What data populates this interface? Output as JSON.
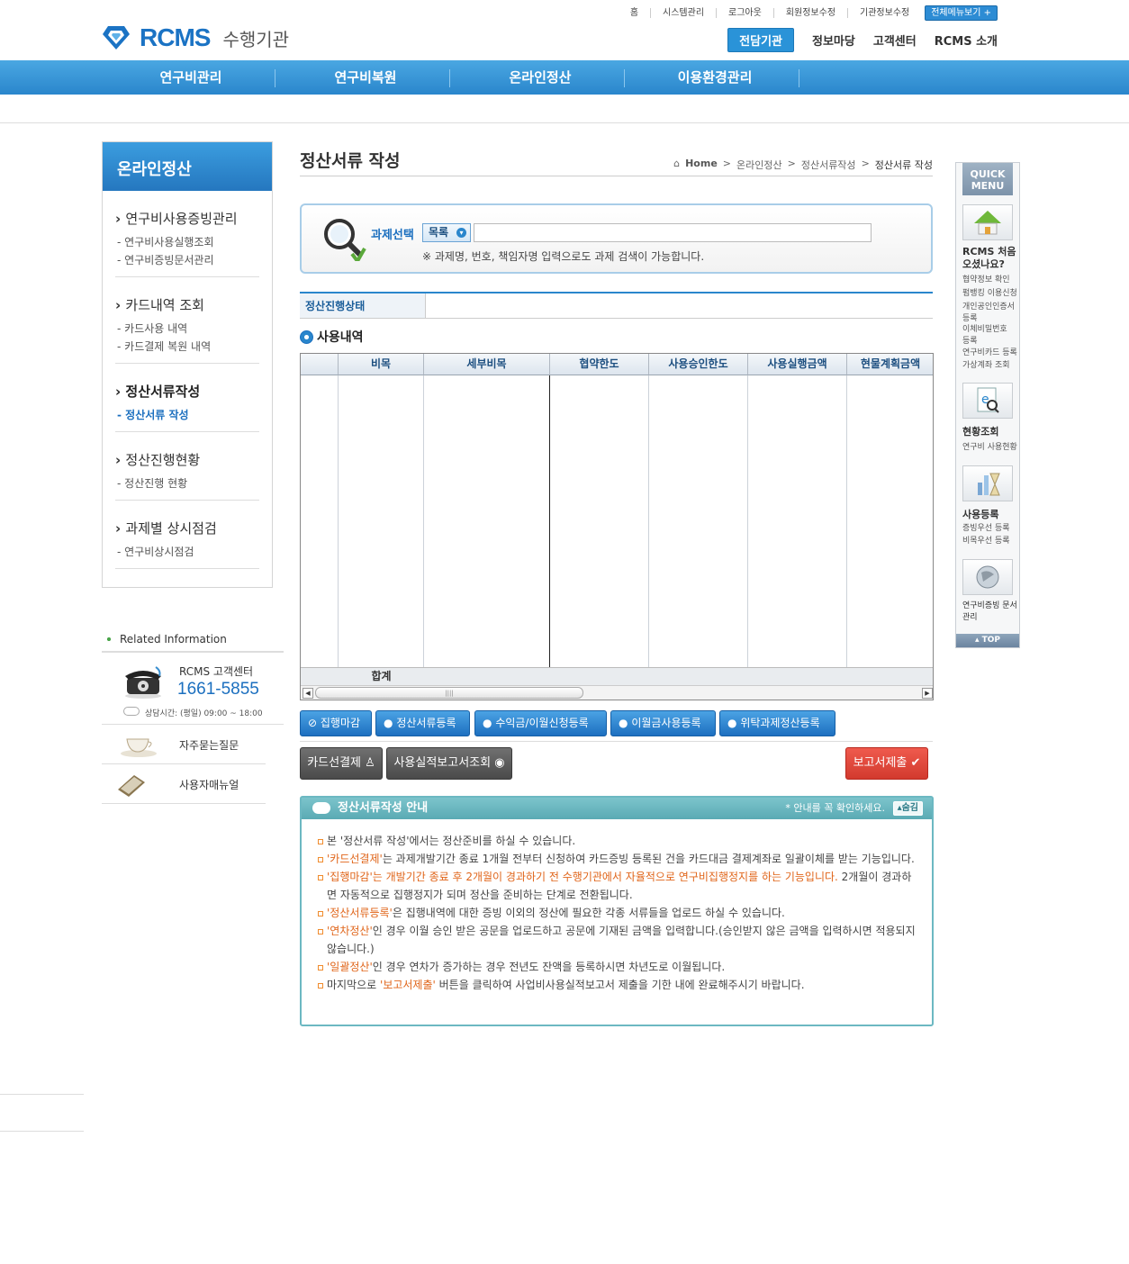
{
  "topnav": {
    "items": [
      "홈",
      "시스템관리",
      "로그아웃",
      "회원정보수정",
      "기관정보수정"
    ],
    "all_menu": "전체메뉴보기 +"
  },
  "logo": {
    "brand": "RCMS",
    "sub": "수행기관"
  },
  "gnb": {
    "items": [
      "전담기관",
      "정보마당",
      "고객센터",
      "RCMS 소개"
    ]
  },
  "mainmenu": [
    "연구비관리",
    "연구비복원",
    "온라인정산",
    "이용환경관리"
  ],
  "sidebar": {
    "title": "온라인정산",
    "groups": [
      {
        "title": "연구비사용증빙관리",
        "items": [
          "연구비사용실행조회",
          "연구비증빙문서관리"
        ]
      },
      {
        "title": "카드내역 조회",
        "items": [
          "카드사용 내역",
          "카드결제 복원 내역"
        ]
      },
      {
        "title": "정산서류작성",
        "items": [
          "정산서류 작성"
        ]
      },
      {
        "title": "정산진행현황",
        "items": [
          "정산진행 현황"
        ]
      },
      {
        "title": "과제별 상시점검",
        "items": [
          "연구비상시점검"
        ]
      }
    ]
  },
  "related": {
    "title": "Related Information",
    "cs_label": "RCMS 고객센터",
    "cs_phone": "1661-5855",
    "cs_hours": "상담시간: (평일) 09:00 ~ 18:00",
    "faq": "자주묻는질문",
    "manual": "사용자매뉴얼"
  },
  "page": {
    "title": "정산서류 작성",
    "breadcrumb": [
      "Home",
      "온라인정산",
      "정산서류작성",
      "정산서류 작성"
    ]
  },
  "search": {
    "label": "과제선택",
    "select": "목록",
    "value": "",
    "hint": "※ 과제명, 번호, 책임자명 입력으로도 과제 검색이 가능합니다."
  },
  "status": {
    "label": "정산진행상태",
    "value": ""
  },
  "usage": {
    "title": "사용내역",
    "columns": [
      "",
      "비목",
      "세부비목",
      "협약한도",
      "사용승인한도",
      "사용실행금액",
      "현물계획금액"
    ],
    "total_label": "합계"
  },
  "actions": {
    "blue": [
      "집행마감",
      "정산서류등록",
      "수익금/이월신청등록",
      "이월금사용등록",
      "위탁과제정산등록"
    ],
    "card": "카드선결제",
    "report_view": "사용실적보고서조회",
    "submit": "보고서제출"
  },
  "guide": {
    "title": "정산서류작성 안내",
    "notice": "* 안내를 꼭 확인하세요.",
    "hide": "숨김",
    "lines": [
      {
        "hl": "",
        "text": "본 '정산서류 작성'에서는 정산준비를 하실 수 있습니다."
      },
      {
        "hl": "'카드선결제'",
        "text": "는 과제개발기간 종료 1개월 전부터 신청하여 카드증빙 등록된 건을 카드대금 결제계좌로 일괄이체를 받는 기능입니다."
      },
      {
        "hl": "'집행마감'는 개발기간 종료 후 2개월이 경과하기 전 수행기관에서 자율적으로 연구비집행정지를 하는 기능입니다.",
        "text": " 2개월이 경과하면 자동적으로 집행정지가 되며 정산을 준비하는 단계로 전환됩니다."
      },
      {
        "hl": "'정산서류등록'",
        "text": "은 집행내역에 대한 증빙 이외의 정산에 필요한 각종 서류들을 업로드 하실 수 있습니다."
      },
      {
        "hl": "'연차정산'",
        "text": "인 경우 이월 승인 받은 공문을 업로드하고 공문에 기재된 금액을 입력합니다.(승인받지 않은 금액을 입력하시면 적용되지 않습니다.)"
      },
      {
        "hl": "'일괄정산'",
        "text": "인 경우 연차가 증가하는 경우 전년도 잔액을 등록하시면 차년도로 이월됩니다."
      },
      {
        "pre": "마지막으로 ",
        "hl": "'보고서제출'",
        "text": " 버튼을 클릭하여 사업비사용실적보고서 제출을 기한 내에 완료해주시기 바랍니다."
      }
    ]
  },
  "quick": {
    "title": "QUICK MENU",
    "first_title": "RCMS 처음 오셨나요?",
    "first_items": [
      "협약정보 확인",
      "펌뱅킹 이용신청",
      "개인공인인증서 등록",
      "이체비밀번호 등록",
      "연구비카드 등록",
      "가상계좌 조회"
    ],
    "status_title": "현황조회",
    "status_sub": "연구비 사용현황",
    "use_title": "사용등록",
    "use_items": [
      "증빙우선 등록",
      "비목우선 등록"
    ],
    "doc_title": "연구비증빙 문서관리",
    "top": "TOP"
  },
  "colors": {
    "accent": "#2a86cc",
    "orange": "#e0651a",
    "red": "#d23a2e"
  }
}
